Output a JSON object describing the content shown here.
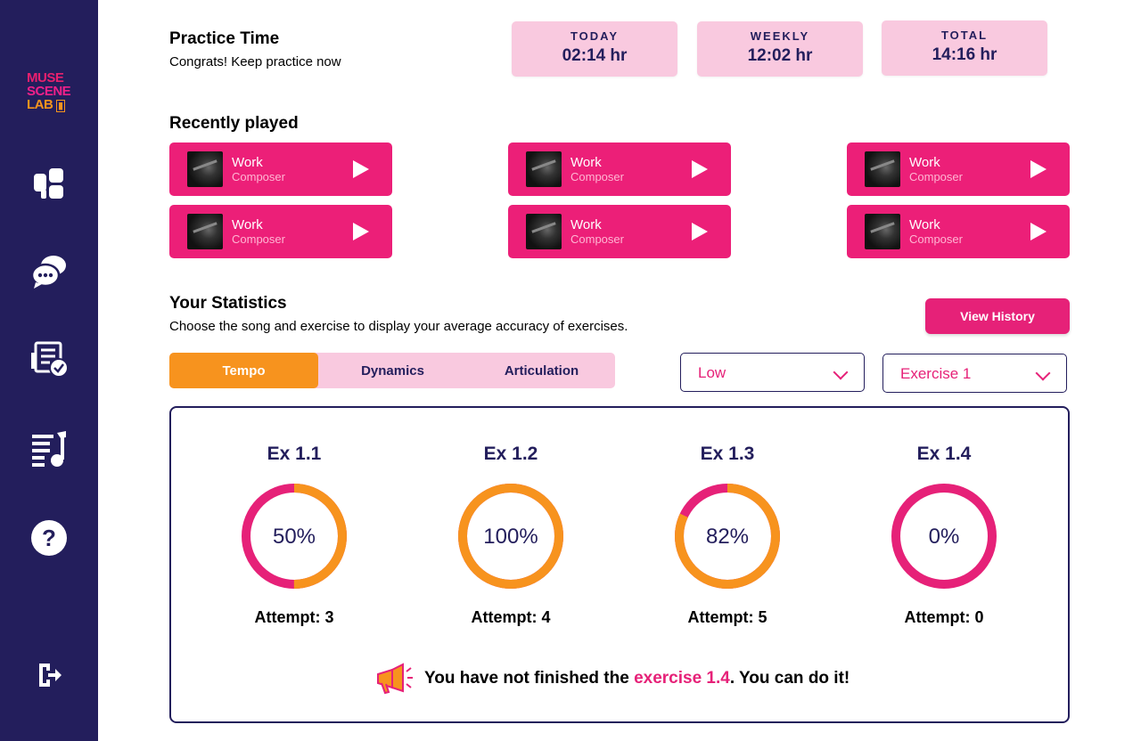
{
  "brand": {
    "logo_line1": "MUSE",
    "logo_line2": "SCENE",
    "logo_line3": "LAB"
  },
  "sidebar": {
    "items": [
      {
        "icon": "dashboard-icon"
      },
      {
        "icon": "chat-icon"
      },
      {
        "icon": "exercises-icon"
      },
      {
        "icon": "music-list-icon"
      },
      {
        "icon": "help-icon"
      },
      {
        "icon": "logout-icon"
      }
    ]
  },
  "practice": {
    "title": "Practice Time",
    "subtitle": "Congrats! Keep practice now",
    "cards": [
      {
        "label": "TODAY",
        "value": "02:14 hr"
      },
      {
        "label": "WEEKLY",
        "value": "12:02 hr"
      },
      {
        "label": "TOTAL",
        "value": "14:16 hr"
      }
    ]
  },
  "recent": {
    "title": "Recently played",
    "songs": [
      {
        "work": "Work",
        "composer": "Composer"
      },
      {
        "work": "Work",
        "composer": "Composer"
      },
      {
        "work": "Work",
        "composer": "Composer"
      },
      {
        "work": "Work",
        "composer": "Composer"
      },
      {
        "work": "Work",
        "composer": "Composer"
      },
      {
        "work": "Work",
        "composer": "Composer"
      }
    ]
  },
  "stats": {
    "title": "Your Statistics",
    "subtitle": "Choose the song and exercise to display your average accuracy of exercises.",
    "view_history": "View History",
    "tabs": [
      {
        "label": "Tempo",
        "active": true
      },
      {
        "label": "Dynamics",
        "active": false
      },
      {
        "label": "Articulation",
        "active": false
      }
    ],
    "level_select": "Low",
    "exercise_select": "Exercise 1",
    "exercises": [
      {
        "title": "Ex 1.1",
        "percent": 50,
        "percent_label": "50%",
        "attempts": "Attempt: 3"
      },
      {
        "title": "Ex 1.2",
        "percent": 100,
        "percent_label": "100%",
        "attempts": "Attempt: 4"
      },
      {
        "title": "Ex 1.3",
        "percent": 82,
        "percent_label": "82%",
        "attempts": "Attempt: 5"
      },
      {
        "title": "Ex 1.4",
        "percent": 0,
        "percent_label": "0%",
        "attempts": "Attempt: 0"
      }
    ],
    "message_pre": "You have not finished the ",
    "message_highlight": "exercise 1.4",
    "message_post": ". You can do it!"
  },
  "colors": {
    "sidebar": "#231e5c",
    "accent_pink": "#ec1f78",
    "accent_orange": "#f7931e",
    "light_pink": "#f9c9df"
  }
}
